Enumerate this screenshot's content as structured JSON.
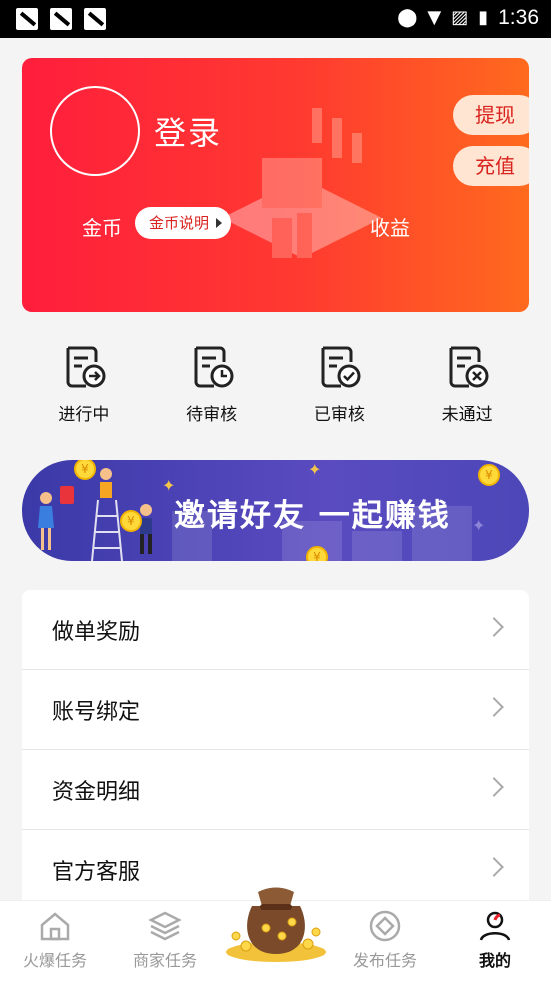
{
  "status_bar": {
    "time": "1:36"
  },
  "profile": {
    "login_label": "登录",
    "withdraw_label": "提现",
    "recharge_label": "充值",
    "coins_label": "金币",
    "coins_help_label": "金币说明",
    "earnings_label": "收益"
  },
  "task_status": [
    {
      "label": "进行中",
      "icon": "task-in-progress-icon"
    },
    {
      "label": "待审核",
      "icon": "task-pending-review-icon"
    },
    {
      "label": "已审核",
      "icon": "task-reviewed-icon"
    },
    {
      "label": "未通过",
      "icon": "task-rejected-icon"
    }
  ],
  "banner": {
    "text": "邀请好友  一起赚钱"
  },
  "menu": [
    {
      "label": "做单奖励"
    },
    {
      "label": "账号绑定"
    },
    {
      "label": "资金明细"
    },
    {
      "label": "官方客服"
    }
  ],
  "tabbar": {
    "tabs": [
      {
        "label": "火爆任务",
        "icon": "home-icon"
      },
      {
        "label": "商家任务",
        "icon": "layers-icon"
      },
      {
        "label": "发布任务",
        "icon": "publish-icon"
      },
      {
        "label": "我的",
        "icon": "profile-icon",
        "active": true
      }
    ]
  },
  "colors": {
    "accent_red": "#ff2a35",
    "accent_orange": "#ff6a1e",
    "banner_purple": "#4c47b8"
  }
}
